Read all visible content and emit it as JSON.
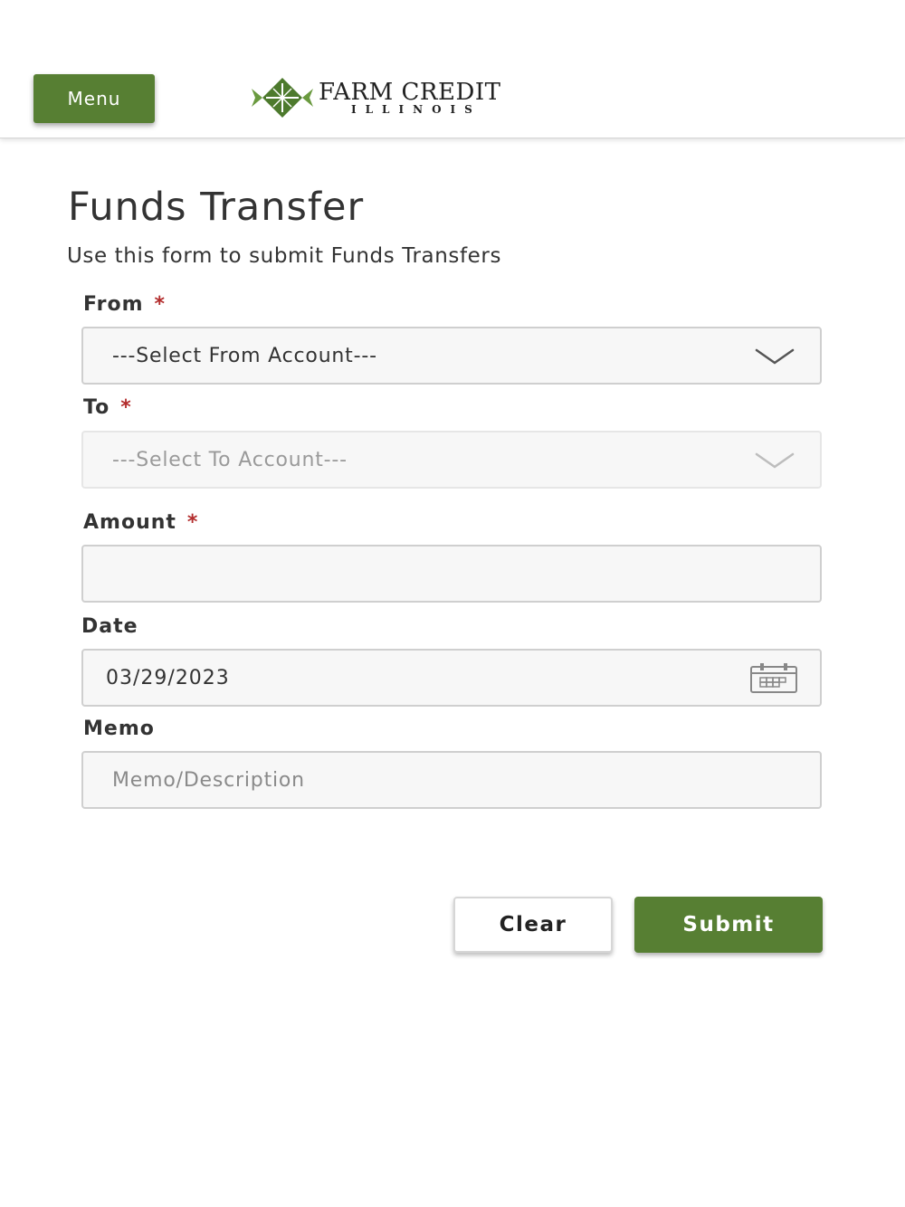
{
  "header": {
    "menu_label": "Menu",
    "logo_name": "FARM CREDIT",
    "logo_sub": "ILLINOIS"
  },
  "page": {
    "title": "Funds Transfer",
    "subtitle": "Use this form to submit Funds Transfers"
  },
  "form": {
    "required_marker": "*",
    "from": {
      "label": "From",
      "selected": "---Select From Account---",
      "icon": "chevron-down-icon"
    },
    "to": {
      "label": "To",
      "selected": "---Select To Account---",
      "disabled": true,
      "icon": "chevron-down-icon"
    },
    "amount": {
      "label": "Amount",
      "value": ""
    },
    "date": {
      "label": "Date",
      "value": "03/29/2023",
      "icon": "calendar-icon"
    },
    "memo": {
      "label": "Memo",
      "value": "",
      "placeholder": "Memo/Description"
    }
  },
  "actions": {
    "clear_label": "Clear",
    "submit_label": "Submit"
  },
  "colors": {
    "brand_green": "#577f33",
    "required_red": "#b32d2d"
  }
}
